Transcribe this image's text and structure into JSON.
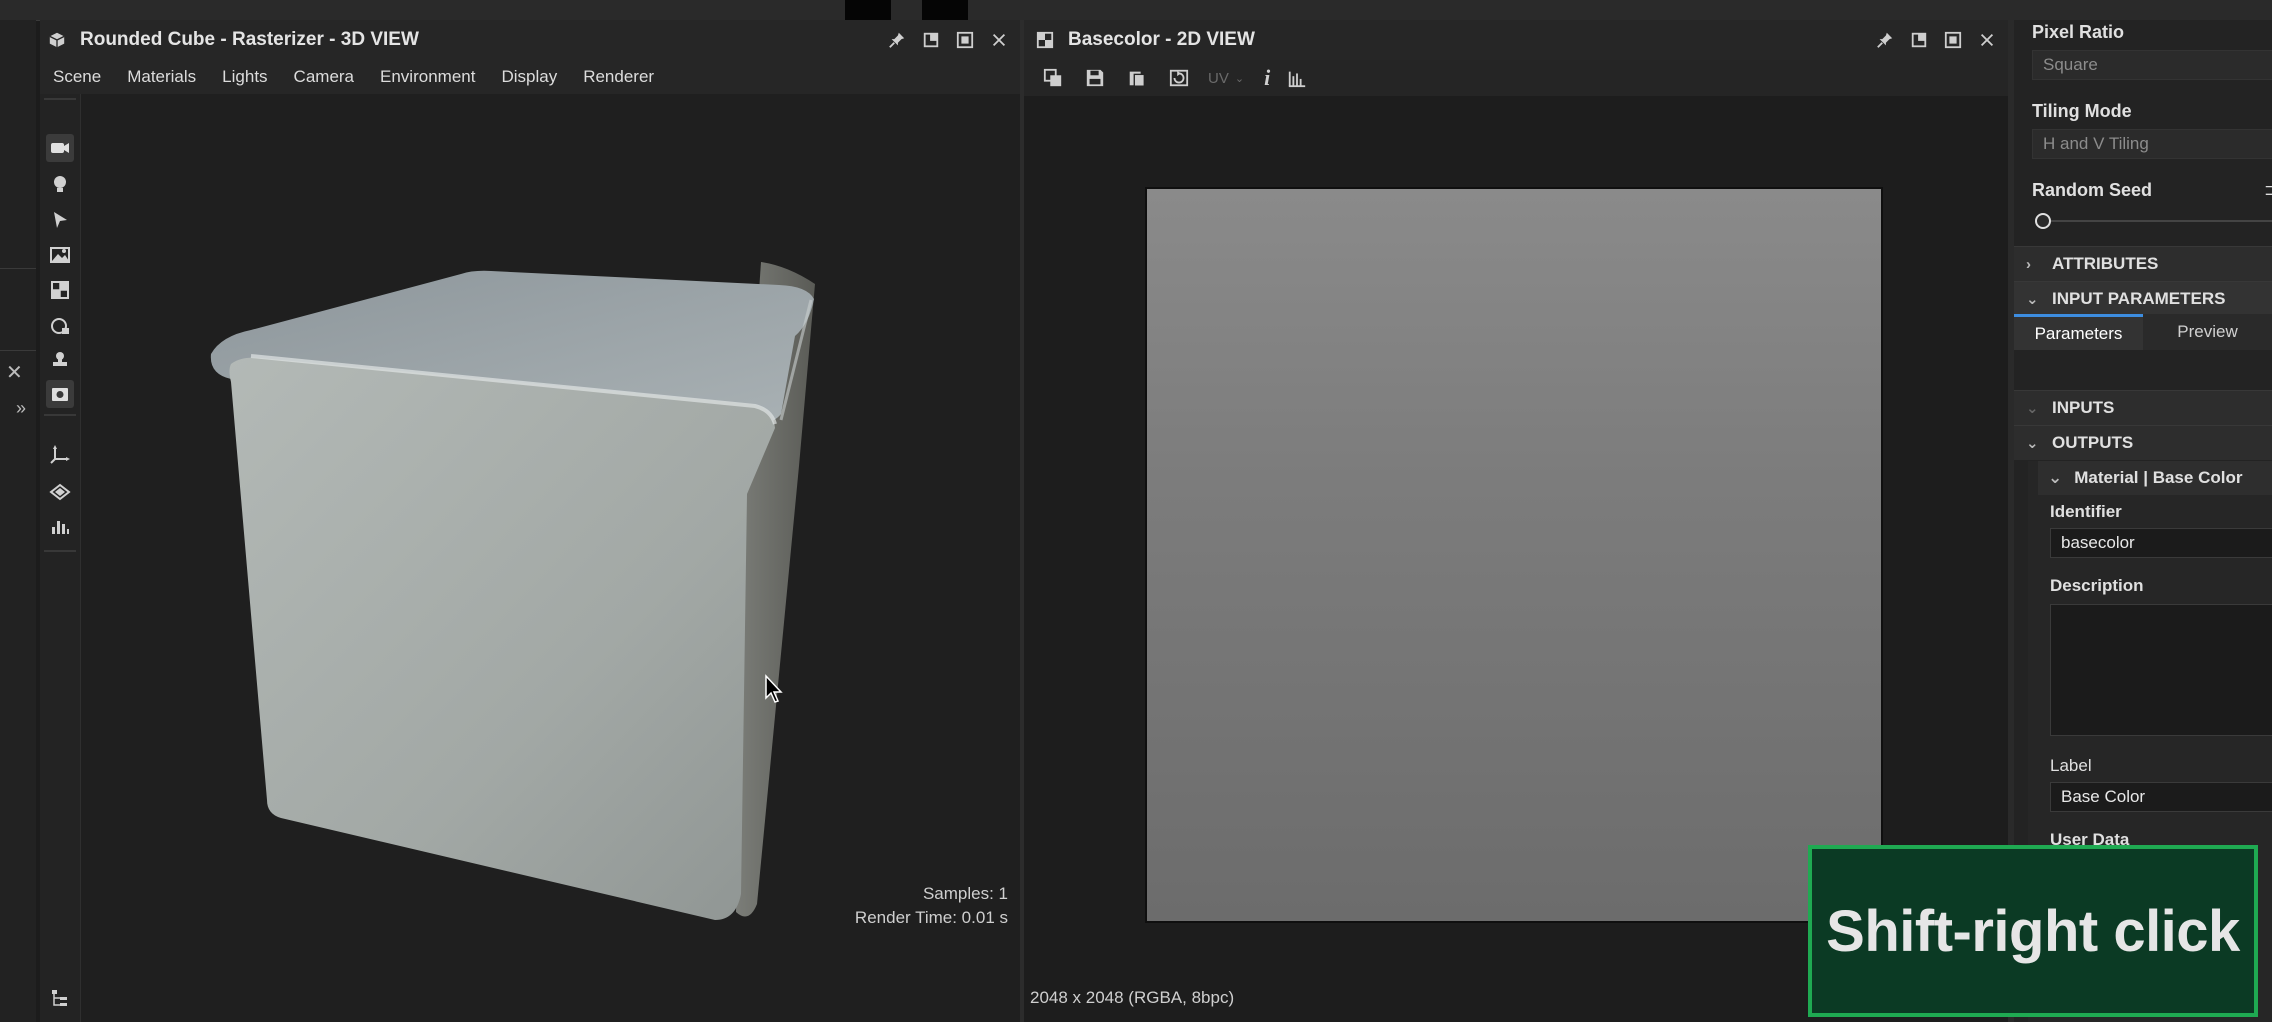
{
  "viewer3d": {
    "title": "Rounded Cube - Rasterizer - 3D VIEW",
    "menu": [
      "Scene",
      "Materials",
      "Lights",
      "Camera",
      "Environment",
      "Display",
      "Renderer"
    ],
    "samples": "Samples: 1",
    "render_time": "Render Time: 0.01 s",
    "header_icons": [
      "pin-icon",
      "float-window-icon",
      "maximize-icon",
      "close-icon"
    ],
    "tools": [
      "camera-icon",
      "light-bulb-icon",
      "select-arrow-icon",
      "environment-icon",
      "grid-icon",
      "shape-icon",
      "stamp-icon",
      "screenshot-icon",
      "axis-gizmo-icon",
      "layers-icon",
      "histogram-icon",
      "hierarchy-icon"
    ]
  },
  "viewer2d": {
    "title": "Basecolor - 2D VIEW",
    "toolbar_uv": "UV",
    "toolbar_info": "i",
    "resolution_info": "2048 x 2048 (RGBA, 8bpc)"
  },
  "properties": {
    "pixel_ratio_label": "Pixel Ratio",
    "pixel_ratio_value": "Square",
    "tiling_mode_label": "Tiling Mode",
    "tiling_mode_value": "H and V Tiling",
    "random_seed_label": "Random Seed",
    "random_seed_value": 0,
    "sections": {
      "attributes": "ATTRIBUTES",
      "input_parameters": "INPUT PARAMETERS",
      "inputs": "INPUTS",
      "outputs": "OUTPUTS"
    },
    "tabs": {
      "parameters": "Parameters",
      "preview": "Preview"
    },
    "output_item": "Material | Base Color",
    "identifier_label": "Identifier",
    "identifier_value": "basecolor",
    "description_label": "Description",
    "description_value": "",
    "label_label": "Label",
    "label_value": "Base Color",
    "user_data_label": "User Data"
  },
  "overlay": {
    "text": "Shift-right click"
  },
  "colors": {
    "accent": "#3d8de0",
    "toast_border": "#1faa52",
    "toast_bg": "#0b3a24"
  }
}
